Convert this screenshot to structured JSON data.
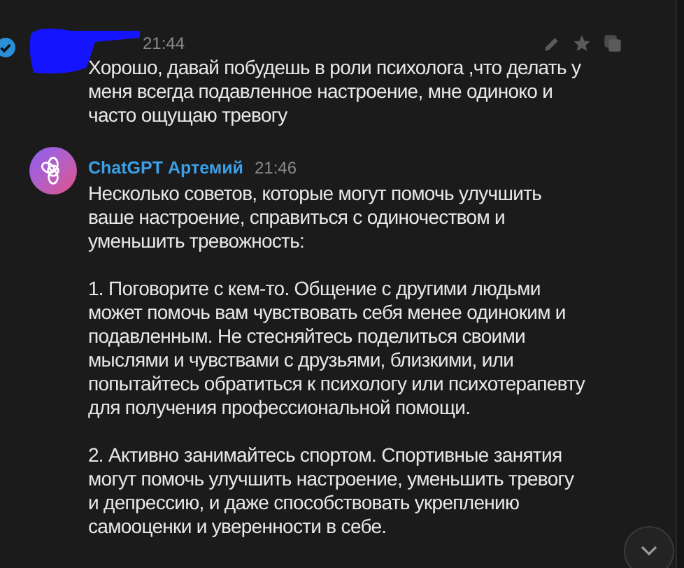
{
  "messages": [
    {
      "kind": "user",
      "time": "21:44",
      "verified": true,
      "paragraphs": [
        "Хорошо, давай побудешь в роли психолога ,что делать у меня всегда подавленное настроение, мне одиноко и часто ощущаю тревогу"
      ]
    },
    {
      "kind": "bot",
      "author": "ChatGPT Артемий",
      "time": "21:46",
      "paragraphs": [
        "Несколько советов, которые могут помочь улучшить ваше настроение, справиться с одиночеством и уменьшить тревожность:",
        "1. Поговорите с кем-то. Общение с другими людьми может помочь вам чувствовать себя менее одиноким и подавленным. Не стесняйтесь поделиться своими мыслями и чувствами с друзьями, близкими, или попытайтесь обратиться к психологу или психотерапевту для получения профессиональной помощи.",
        "2. Активно занимайтесь спортом. Спортивные занятия могут помочь улучшить настроение, уменьшить тревогу и депрессию, и даже способствовать укреплению самооценки и уверенности в себе."
      ]
    }
  ]
}
